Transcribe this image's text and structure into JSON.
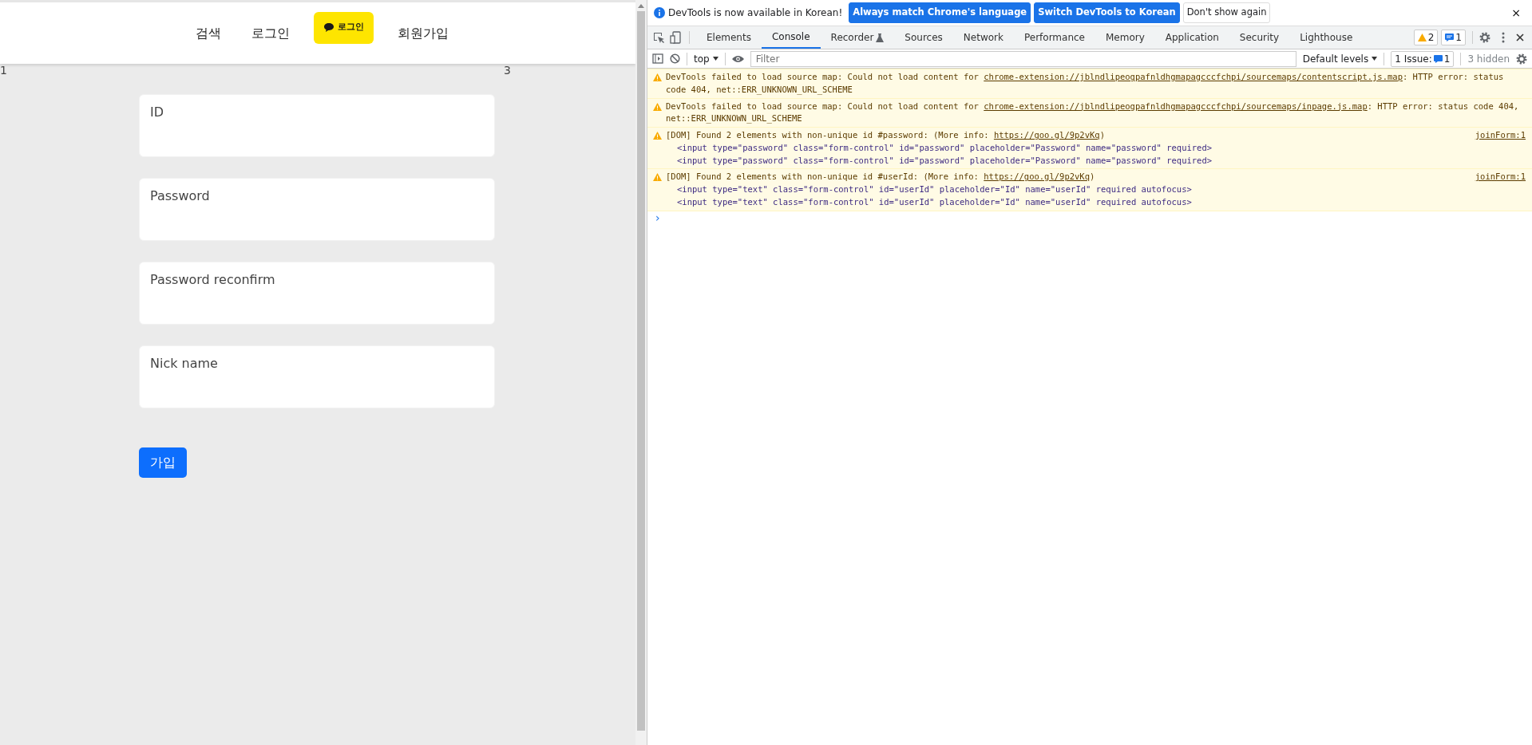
{
  "page": {
    "nav": [
      {
        "label": "검색",
        "kind": "link"
      },
      {
        "label": "로그인",
        "kind": "link"
      },
      {
        "label": "로그인",
        "kind": "kakao"
      },
      {
        "label": "회원가입",
        "kind": "link"
      }
    ],
    "markers": [
      "1",
      "3"
    ],
    "fields": [
      {
        "placeholder": "ID"
      },
      {
        "placeholder": "Password"
      },
      {
        "placeholder": "Password reconfirm"
      },
      {
        "placeholder": "Nick name"
      }
    ],
    "submit": "가입"
  },
  "devtools": {
    "infobar": {
      "message": "DevTools is now available in Korean!",
      "buttons": [
        {
          "label": "Always match Chrome's language",
          "kind": "primary"
        },
        {
          "label": "Switch DevTools to Korean",
          "kind": "primary"
        },
        {
          "label": "Don't show again",
          "kind": "plain"
        }
      ],
      "close": "×"
    },
    "tabs": [
      {
        "label": "Elements",
        "selected": false
      },
      {
        "label": "Console",
        "selected": true
      },
      {
        "label": "Recorder",
        "selected": false,
        "kind": "flask"
      },
      {
        "label": "Sources",
        "selected": false
      },
      {
        "label": "Network",
        "selected": false
      },
      {
        "label": "Performance",
        "selected": false
      },
      {
        "label": "Memory",
        "selected": false
      },
      {
        "label": "Application",
        "selected": false
      },
      {
        "label": "Security",
        "selected": false
      },
      {
        "label": "Lighthouse",
        "selected": false
      }
    ],
    "warning_count": "2",
    "message_count": "1",
    "toolbar": {
      "context": "top",
      "filter_placeholder": "Filter",
      "levels": "Default levels",
      "issues": "1 Issue:",
      "issues_count": "1",
      "hidden": "3 hidden"
    },
    "messages": [
      {
        "kind": "warning",
        "before": "DevTools failed to load source map: Could not load content for ",
        "link": "chrome-extension://jblndlipeogpafnldhgmapagcccfchpi/sourcemaps/contentscript.js.map",
        "after": ": HTTP error: status code 404, net::ERR_UNKNOWN_URL_SCHEME"
      },
      {
        "kind": "warning",
        "before": "DevTools failed to load source map: Could not load content for ",
        "link": "chrome-extension://jblndlipeogpafnldhgmapagcccfchpi/sourcemaps/inpage.js.map",
        "after": ": HTTP error: status code 404, net::ERR_UNKNOWN_URL_SCHEME"
      },
      {
        "kind": "warning",
        "before": "[DOM] Found 2 elements with non-unique id #password: (More info: ",
        "link": "https://goo.gl/9p2vKq",
        "after": ")",
        "source": "joinForm:1",
        "lines": [
          "<input type=\"password\" class=\"form-control\" id=\"password\" placeholder=\"Password\" name=\"password\" required>",
          "<input type=\"password\" class=\"form-control\" id=\"password\" placeholder=\"Password\" name=\"password\" required>"
        ]
      },
      {
        "kind": "warning",
        "before": "[DOM] Found 2 elements with non-unique id #userId: (More info: ",
        "link": "https://goo.gl/9p2vKq",
        "after": ")",
        "source": "joinForm:1",
        "lines": [
          "<input type=\"text\" class=\"form-control\" id=\"userId\" placeholder=\"Id\" name=\"userId\" required autofocus>",
          "<input type=\"text\" class=\"form-control\" id=\"userId\" placeholder=\"Id\" name=\"userId\" required autofocus>"
        ]
      }
    ],
    "prompt": "›"
  }
}
